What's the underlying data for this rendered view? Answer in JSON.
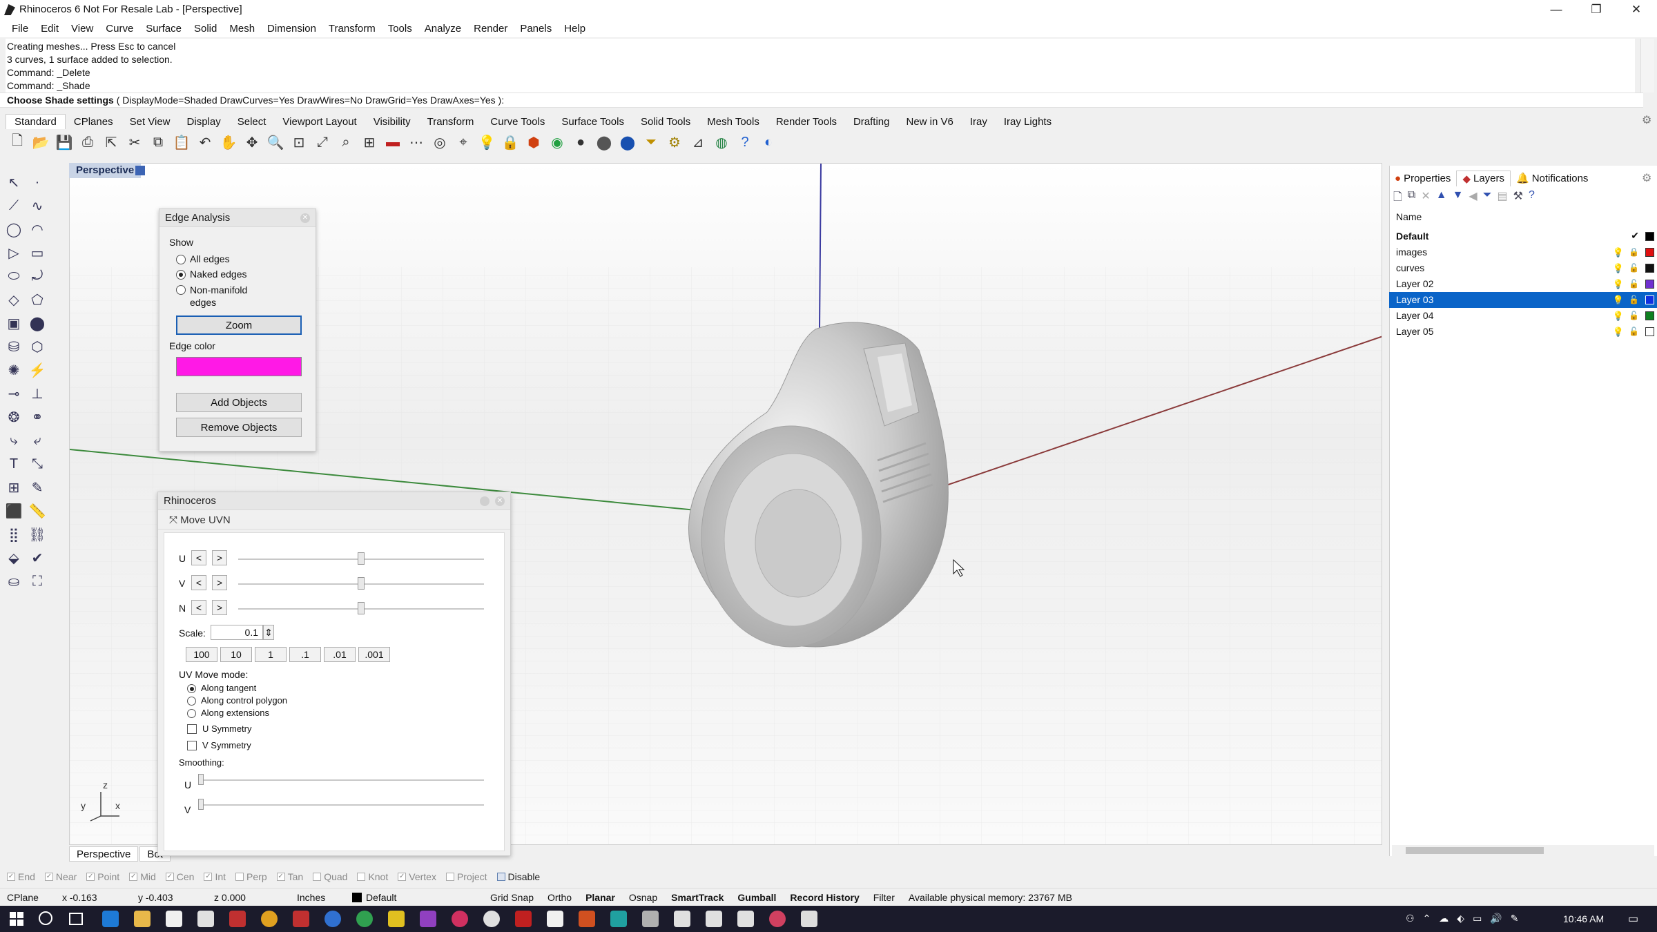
{
  "window": {
    "title": "Rhinoceros 6 Not For Resale Lab - [Perspective]",
    "minimize": "—",
    "restore": "❐",
    "close": "✕"
  },
  "menu": [
    "File",
    "Edit",
    "View",
    "Curve",
    "Surface",
    "Solid",
    "Mesh",
    "Dimension",
    "Transform",
    "Tools",
    "Analyze",
    "Render",
    "Panels",
    "Help"
  ],
  "command_history": [
    "Creating meshes... Press Esc to cancel",
    "3 curves, 1 surface added to selection.",
    "Command: _Delete",
    "Command: _Shade"
  ],
  "command_prompt": {
    "label": "Choose Shade settings",
    "options": "( DisplayMode=Shaded  DrawCurves=Yes  DrawWires=No  DrawGrid=Yes  DrawAxes=Yes ):"
  },
  "toolbar_tabs": [
    "Standard",
    "CPlanes",
    "Set View",
    "Display",
    "Select",
    "Viewport Layout",
    "Visibility",
    "Transform",
    "Curve Tools",
    "Surface Tools",
    "Solid Tools",
    "Mesh Tools",
    "Render Tools",
    "Drafting",
    "New in V6",
    "Iray",
    "Iray Lights"
  ],
  "viewport": {
    "name": "Perspective",
    "tabs": [
      "Perspective",
      "Bot"
    ],
    "axes": {
      "z": "z",
      "y": "y",
      "x": "x"
    }
  },
  "edge_analysis": {
    "title": "Edge Analysis",
    "show_label": "Show",
    "options": [
      "All edges",
      "Naked edges",
      "Non-manifold edges"
    ],
    "selected": "Naked edges",
    "zoom_button": "Zoom",
    "edge_color_label": "Edge color",
    "edge_color": "#ff19e6",
    "add_button": "Add Objects",
    "remove_button": "Remove Objects"
  },
  "move_uvn": {
    "window_title": "Rhinoceros",
    "title": "Move UVN",
    "rows": [
      "U",
      "V",
      "N"
    ],
    "scale_label": "Scale:",
    "scale_value": "0.1",
    "scale_buttons": [
      "100",
      "10",
      "1",
      ".1",
      ".01",
      ".001"
    ],
    "uv_mode_label": "UV Move mode:",
    "uv_modes": [
      "Along tangent",
      "Along control polygon",
      "Along extensions"
    ],
    "uv_mode_selected": "Along tangent",
    "u_symmetry": "U Symmetry",
    "v_symmetry": "V Symmetry",
    "smoothing_label": "Smoothing:",
    "smoothing_rows": [
      "U",
      "V"
    ]
  },
  "right_panel": {
    "tabs": [
      "Properties",
      "Layers",
      "Notifications"
    ],
    "active_tab": "Layers",
    "column_name": "Name",
    "layers": [
      {
        "name": "Default",
        "color": "#000000",
        "current": true
      },
      {
        "name": "images",
        "color": "#e01010"
      },
      {
        "name": "curves",
        "color": "#111111"
      },
      {
        "name": "Layer 02",
        "color": "#7030d0"
      },
      {
        "name": "Layer 03",
        "color": "#1030e0",
        "selected": true
      },
      {
        "name": "Layer 04",
        "color": "#108020"
      },
      {
        "name": "Layer 05",
        "color": "#ffffff"
      }
    ]
  },
  "osnaps": [
    {
      "label": "End",
      "checked": true
    },
    {
      "label": "Near",
      "checked": true
    },
    {
      "label": "Point",
      "checked": true
    },
    {
      "label": "Mid",
      "checked": true
    },
    {
      "label": "Cen",
      "checked": true
    },
    {
      "label": "Int",
      "checked": true
    },
    {
      "label": "Perp",
      "checked": false
    },
    {
      "label": "Tan",
      "checked": true
    },
    {
      "label": "Quad",
      "checked": false
    },
    {
      "label": "Knot",
      "checked": false
    },
    {
      "label": "Vertex",
      "checked": true
    },
    {
      "label": "Project",
      "checked": false
    },
    {
      "label": "Disable",
      "checked": false
    }
  ],
  "status": {
    "cplane": "CPlane",
    "x": "x -0.163",
    "y": "y -0.403",
    "z": "z 0.000",
    "units": "Inches",
    "layer": "Default",
    "grid_snap": "Grid Snap",
    "ortho": "Ortho",
    "planar": "Planar",
    "osnap": "Osnap",
    "smarttrack": "SmartTrack",
    "gumball": "Gumball",
    "record_history": "Record History",
    "filter": "Filter",
    "memory": "Available physical memory: 23767 MB"
  },
  "taskbar": {
    "time": "10:46 AM"
  }
}
